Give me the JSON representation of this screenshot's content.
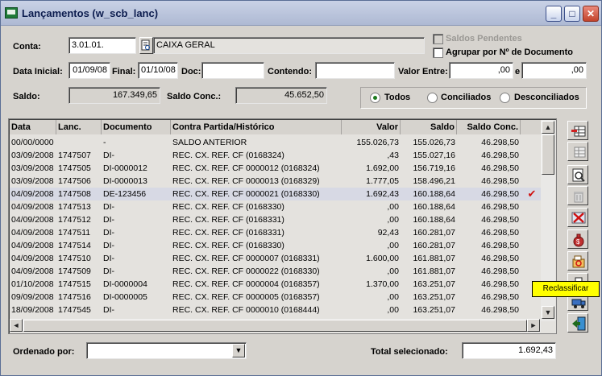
{
  "window": {
    "title": "Lançamentos (w_scb_lanc)"
  },
  "form": {
    "conta_label": "Conta:",
    "conta_value": "3.01.01.",
    "conta_desc": "CAIXA GERAL",
    "saldos_pendentes_label": "Saldos Pendentes",
    "agrupar_label": "Agrupar por Nº de Documento",
    "data_inicial_label": "Data Inicial:",
    "data_inicial_value": "01/09/08",
    "final_label": "Final:",
    "final_value": "01/10/08",
    "doc_label": "Doc:",
    "doc_value": "",
    "contendo_label": "Contendo:",
    "contendo_value": "",
    "valor_entre_label": "Valor Entre:",
    "valor_min": ",00",
    "e_label": "e",
    "valor_max": ",00",
    "saldo_label": "Saldo:",
    "saldo_value": "167.349,65",
    "saldo_conc_label": "Saldo Conc.:",
    "saldo_conc_value": "45.652,50",
    "filter_options": [
      "Todos",
      "Conciliados",
      "Desconciliados"
    ],
    "filter_selected": "Todos"
  },
  "table": {
    "columns": [
      "Data",
      "Lanc.",
      "Documento",
      "Contra Partida/Histórico",
      "Valor",
      "Saldo",
      "Saldo Conc."
    ],
    "rows": [
      [
        "00/00/0000",
        "",
        "-",
        "SALDO ANTERIOR",
        "155.026,73",
        "155.026,73",
        "46.298,50",
        ""
      ],
      [
        "03/09/2008",
        "1747507",
        "DI-",
        "REC. CX. REF. CF  (0168324)",
        ",43",
        "155.027,16",
        "46.298,50",
        ""
      ],
      [
        "03/09/2008",
        "1747505",
        "DI-0000012",
        "REC. CX. REF. CF 0000012 (0168324)",
        "1.692,00",
        "156.719,16",
        "46.298,50",
        ""
      ],
      [
        "03/09/2008",
        "1747506",
        "DI-0000013",
        "REC. CX. REF. CF 0000013 (0168329)",
        "1.777,05",
        "158.496,21",
        "46.298,50",
        ""
      ],
      [
        "04/09/2008",
        "1747508",
        "DE-123456",
        "REC. CX. REF. CF 0000021 (0168330)",
        "1.692,43",
        "160.188,64",
        "46.298,50",
        "✔"
      ],
      [
        "04/09/2008",
        "1747513",
        "DI-",
        "REC. CX. REF. CF  (0168330)",
        ",00",
        "160.188,64",
        "46.298,50",
        ""
      ],
      [
        "04/09/2008",
        "1747512",
        "DI-",
        "REC. CX. REF. CF  (0168331)",
        ",00",
        "160.188,64",
        "46.298,50",
        ""
      ],
      [
        "04/09/2008",
        "1747511",
        "DI-",
        "REC. CX. REF. CF  (0168331)",
        "92,43",
        "160.281,07",
        "46.298,50",
        ""
      ],
      [
        "04/09/2008",
        "1747514",
        "DI-",
        "REC. CX. REF. CF  (0168330)",
        ",00",
        "160.281,07",
        "46.298,50",
        ""
      ],
      [
        "04/09/2008",
        "1747510",
        "DI-",
        "REC. CX. REF. CF 0000007 (0168331)",
        "1.600,00",
        "161.881,07",
        "46.298,50",
        ""
      ],
      [
        "04/09/2008",
        "1747509",
        "DI-",
        "REC. CX. REF. CF 0000022 (0168330)",
        ",00",
        "161.881,07",
        "46.298,50",
        ""
      ],
      [
        "01/10/2008",
        "1747515",
        "DI-0000004",
        "REC. CX. REF. CF 0000004 (0168357)",
        "1.370,00",
        "163.251,07",
        "46.298,50",
        ""
      ],
      [
        "09/09/2008",
        "1747516",
        "DI-0000005",
        "REC. CX. REF. CF 0000005 (0168357)",
        ",00",
        "163.251,07",
        "46.298,50",
        ""
      ],
      [
        "18/09/2008",
        "1747545",
        "DI-",
        "REC. CX. REF. CF 0000010 (0168444)",
        ",00",
        "163.251,07",
        "46.298,50",
        ""
      ]
    ],
    "selected_row": 4
  },
  "tooltip": {
    "text": "Reclassificar"
  },
  "footer": {
    "ordenado_label": "Ordenado por:",
    "ordenado_value": "",
    "total_label": "Total selecionado:",
    "total_value": "1.692,43"
  }
}
